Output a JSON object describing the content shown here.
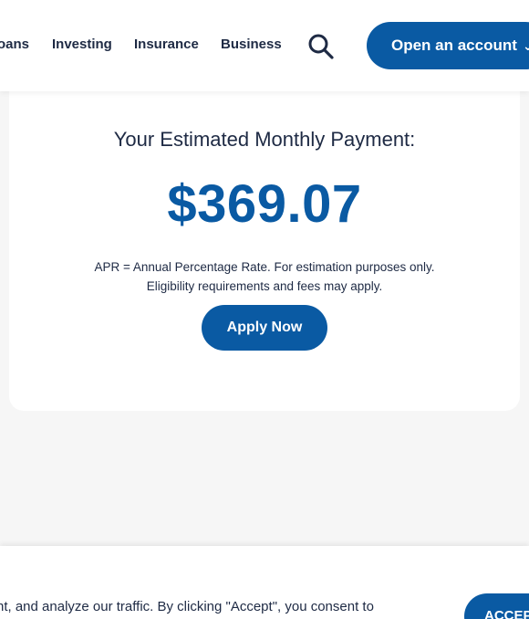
{
  "header": {
    "nav": [
      "oans",
      "Investing",
      "Insurance",
      "Business"
    ],
    "search_icon": "search-icon",
    "open_account_label": "Open an account",
    "open_account_chevron": "chevron-down-icon"
  },
  "payment": {
    "title": "Your Estimated Monthly Payment:",
    "amount": "$369.07",
    "disclaimer_line1": "APR = Annual Percentage Rate. For estimation purposes only.",
    "disclaimer_line2": "Eligibility requirements and fees may apply.",
    "apply_label": "Apply Now"
  },
  "cookie_banner": {
    "text": "nt, and analyze our traffic. By clicking \"Accept\", you consent to",
    "accept_label": "ACCEPT"
  },
  "colors": {
    "brand_blue": "#0a5aa3",
    "text_navy": "#1e2a44",
    "background": "#f6f6f6"
  }
}
